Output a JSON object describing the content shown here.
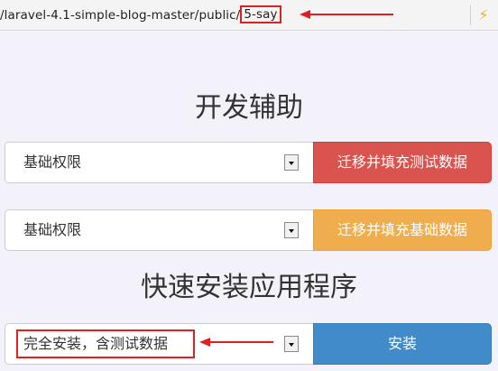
{
  "browser": {
    "url_prefix": "/laravel-4.1-simple-blog-master/public/",
    "url_highlight": "5-say"
  },
  "dev_tools": {
    "heading": "开发辅助",
    "row1": {
      "select_value": "基础权限",
      "button_label": "迁移并填充测试数据"
    },
    "row2": {
      "select_value": "基础权限",
      "button_label": "迁移并填充基础数据"
    }
  },
  "install": {
    "heading": "快速安装应用程序",
    "select_value": "完全安装，含测试数据",
    "button_label": "安装"
  },
  "colors": {
    "danger": "#d9534f",
    "warning": "#f0ad4e",
    "primary": "#428bca",
    "annotation": "#e02020"
  }
}
